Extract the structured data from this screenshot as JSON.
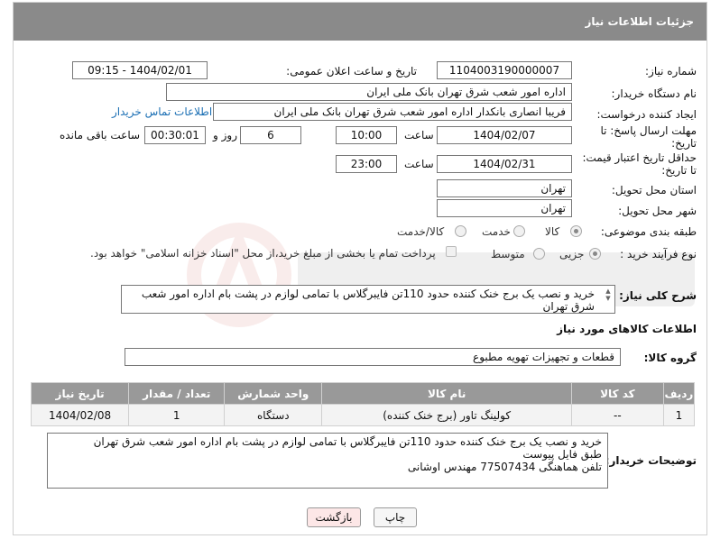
{
  "header": {
    "title": "جزئیات اطلاعات نیاز"
  },
  "fields": {
    "need_number": {
      "label": "شماره نیاز:",
      "value": "1104003190000007"
    },
    "announce_datetime": {
      "label": "تاریخ و ساعت اعلان عمومی:",
      "value": "1404/02/01 - 09:15"
    },
    "buyer_org": {
      "label": "نام دستگاه خریدار:",
      "value": "اداره امور شعب شرق تهران بانک ملی ایران"
    },
    "requester": {
      "label": "ایجاد کننده درخواست:",
      "value": "فریبا  انصاری  بانکدار  اداره امور شعب شرق تهران بانک ملی ایران",
      "contact_link": "اطلاعات تماس خریدار"
    },
    "reply_deadline": {
      "label_line1": "مهلت ارسال پاسخ: تا",
      "label_line2": "تاریخ:",
      "date": "1404/02/07",
      "time_label": "ساعت",
      "time": "10:00",
      "days": "6",
      "days_label": "روز و",
      "remaining": "00:30:01",
      "remaining_label": "ساعت باقی مانده"
    },
    "price_validity": {
      "label_line1": "حداقل تاریخ اعتبار قیمت:",
      "label_line2": "تا تاریخ:",
      "date": "1404/02/31",
      "time_label": "ساعت",
      "time": "23:00"
    },
    "delivery_province": {
      "label": "استان محل تحویل:",
      "value": "تهران"
    },
    "delivery_city": {
      "label": "شهر محل تحویل:",
      "value": "تهران"
    },
    "category": {
      "label": "طبقه بندی موضوعی:",
      "options": [
        "کالا",
        "خدمت",
        "کالا/خدمت"
      ],
      "selected": "کالا"
    },
    "process_type": {
      "label": "نوع فرآیند خرید :",
      "options": [
        "جزیی",
        "متوسط"
      ],
      "selected": "جزیی",
      "payment_note": "پرداخت تمام یا بخشی از مبلغ خرید،از محل \"اسناد خزانه اسلامی\" خواهد بود."
    }
  },
  "description": {
    "label": "شرح کلی نیاز:",
    "value": "خرید و نصب یک برج خنک کننده حدود 110تن فایبرگلاس با تمامی لوازم در پشت بام اداره امور شعب شرق تهران"
  },
  "goods_section": {
    "title": "اطلاعات کالاهای مورد نیاز",
    "group_label": "گروه کالا:",
    "group_value": "قطعات و تجهیزات تهویه مطبوع"
  },
  "table": {
    "columns": [
      "ردیف",
      "کد کالا",
      "نام کالا",
      "واحد شمارش",
      "تعداد / مقدار",
      "تاریخ نیاز"
    ],
    "rows": [
      [
        "1",
        "--",
        "کولینگ تاور (برج خنک کننده)",
        "دستگاه",
        "1",
        "1404/02/08"
      ]
    ]
  },
  "buyer_notes": {
    "label": "توضیحات خریدار:",
    "lines": [
      "خرید و نصب یک برج خنک کننده حدود 110تن فایبرگلاس با تمامی لوازم در پشت بام اداره امور شعب شرق تهران",
      "طبق فایل پیوست",
      "تلفن هماهنگی 77507434 مهندس اوشانی"
    ]
  },
  "buttons": {
    "print": "چاپ",
    "back": "بازگشت"
  },
  "colors": {
    "header_bg": "#8a8a8a",
    "table_header_bg": "#999999",
    "link": "#1b6fb4",
    "back_button_bg": "#fde7e7"
  }
}
